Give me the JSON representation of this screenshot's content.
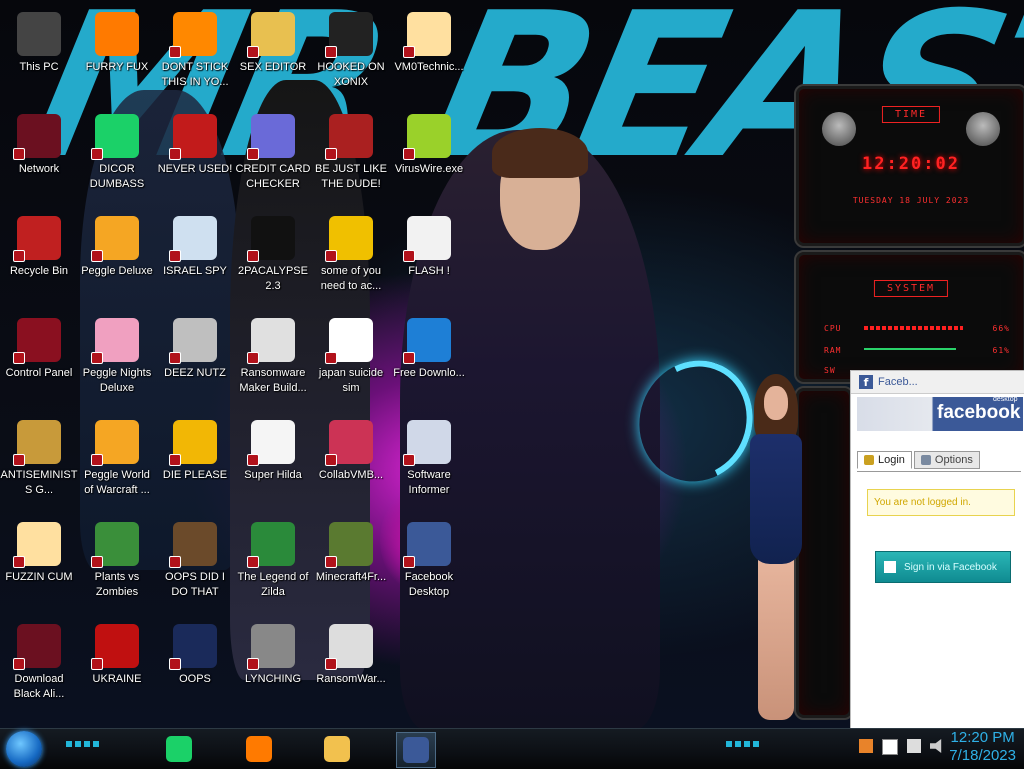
{
  "wallpaper": {
    "title_text": "MR BEAST"
  },
  "desktop_icons": [
    {
      "label": "This PC",
      "icon": "computer-icon",
      "color": "#444"
    },
    {
      "label": "FURRY FUX",
      "icon": "firefox-icon",
      "color": "#ff7a00"
    },
    {
      "label": "DONT STICK THIS IN YO...",
      "icon": "vlc-icon",
      "color": "#ff8800"
    },
    {
      "label": "SEX EDITOR",
      "icon": "hxd-icon",
      "color": "#e8c050"
    },
    {
      "label": "HOOKED ON XONIX",
      "icon": "xonix-icon",
      "color": "#222"
    },
    {
      "label": "VM0Technic...",
      "icon": "anime-star-icon",
      "color": "#ffe0a0"
    },
    {
      "label": "Network",
      "icon": "network-globe-icon",
      "color": "#6b1020"
    },
    {
      "label": "DICOR DUMBASS",
      "icon": "chat-app-icon",
      "color": "#1bd168"
    },
    {
      "label": "NEVER USED!",
      "icon": "dev-cpp-icon",
      "color": "#c21b1b"
    },
    {
      "label": "CREDIT CARD CHECKER",
      "icon": "credit-card-icon",
      "color": "#6a6ad8"
    },
    {
      "label": "BE JUST LIKE THE DUDE!",
      "icon": "dude-icon",
      "color": "#aa2020"
    },
    {
      "label": "VirusWire.exe",
      "icon": "lime-icon",
      "color": "#9ad12a"
    },
    {
      "label": "Recycle Bin",
      "icon": "recycle-bin-icon",
      "color": "#c02020"
    },
    {
      "label": "Peggle Deluxe",
      "icon": "peggle-icon",
      "color": "#f5a623"
    },
    {
      "label": "ISRAEL SPY",
      "icon": "network-spy-icon",
      "color": "#cfe0f0"
    },
    {
      "label": "2PACALYPSE 2.3",
      "icon": "terminal-icon",
      "color": "#111"
    },
    {
      "label": "some of you need to ac...",
      "icon": "dog-icon",
      "color": "#f0c000"
    },
    {
      "label": "FLASH !",
      "icon": "flash-icon",
      "color": "#f2f2f2"
    },
    {
      "label": "Control Panel",
      "icon": "control-panel-icon",
      "color": "#8a1020"
    },
    {
      "label": "Peggle Nights Deluxe",
      "icon": "peggle-nights-icon",
      "color": "#f0a0c0"
    },
    {
      "label": "DEEZ NUTZ",
      "icon": "windows-stack-icon",
      "color": "#bfbfbf"
    },
    {
      "label": "Ransomware Maker Build...",
      "icon": "app-window-icon",
      "color": "#e0e0e0"
    },
    {
      "label": "japan suicide sim",
      "icon": "document-icon",
      "color": "#ffffff"
    },
    {
      "label": "Free Downlo...",
      "icon": "download-arrow-icon",
      "color": "#1e7fd6"
    },
    {
      "label": "ANTISEMINISTS G...",
      "icon": "money-bag-icon",
      "color": "#c89a3a"
    },
    {
      "label": "Peggle World of Warcraft ...",
      "icon": "peggle-wow-icon",
      "color": "#f5a623"
    },
    {
      "label": "DIE PLEASE",
      "icon": "de-icon",
      "color": "#f2b705"
    },
    {
      "label": "Super Hilda",
      "icon": "pixel-sprite-icon",
      "color": "#f5f5f5"
    },
    {
      "label": "CollabVMB...",
      "icon": "monitor-icon",
      "color": "#cc3355"
    },
    {
      "label": "Software Informer",
      "icon": "software-informer-icon",
      "color": "#d0d8e8"
    },
    {
      "label": "FUZZIN CUM",
      "icon": "anime-star-icon",
      "color": "#ffe0a0"
    },
    {
      "label": "Plants vs Zombies",
      "icon": "plants-vs-zombies-icon",
      "color": "#3a8f3a"
    },
    {
      "label": "OOPS DID I DO THAT",
      "icon": "portrait-icon",
      "color": "#6b4a2a"
    },
    {
      "label": "The Legend of Zilda",
      "icon": "zelda-sprite-icon",
      "color": "#2a8a3a"
    },
    {
      "label": "Minecraft4Fr...",
      "icon": "minecraft-block-icon",
      "color": "#5a7a30"
    },
    {
      "label": "Facebook Desktop",
      "icon": "facebook-icon",
      "color": "#3b5998"
    },
    {
      "label": "Download Black Ali...",
      "icon": "alien-globe-icon",
      "color": "#6b1020"
    },
    {
      "label": "UKRAINE",
      "icon": "radiation-icon",
      "color": "#c01010"
    },
    {
      "label": "OOPS",
      "icon": "book-icon",
      "color": "#1a2a5a"
    },
    {
      "label": "LYNCHING",
      "icon": "knot-icon",
      "color": "#888"
    },
    {
      "label": "RansomWar...",
      "icon": "skull-icon",
      "color": "#ddd"
    }
  ],
  "gadget_clock": {
    "title": "TIME",
    "time": "12:20:02",
    "date": "TUESDAY 18 JULY 2023"
  },
  "gadget_system": {
    "title": "SYSTEM",
    "rows": [
      {
        "label": "CPU",
        "value": "66%",
        "fraction": 0.66
      },
      {
        "label": "RAM",
        "value": "61%",
        "fraction": 0.61
      },
      {
        "label": "SW",
        "value": ""
      }
    ]
  },
  "facebook": {
    "header_title": "Faceb...",
    "brand": "facebook",
    "brand_sub": "desktop",
    "tabs": [
      {
        "label": "Login"
      },
      {
        "label": "Options"
      }
    ],
    "notice": "You are not logged in.",
    "button": "Sign in via Facebook"
  },
  "taskbar": {
    "apps": [
      {
        "icon": "chat-app-icon"
      },
      {
        "icon": "firefox-icon"
      },
      {
        "icon": "file-explorer-icon"
      },
      {
        "icon": "facebook-icon",
        "active": true
      }
    ],
    "clock_time": "12:20 PM",
    "clock_date": "7/18/2023"
  },
  "colors": {
    "accent": "#2fb0e6",
    "red_led": "#ff2222",
    "facebook_blue": "#3b5998"
  }
}
